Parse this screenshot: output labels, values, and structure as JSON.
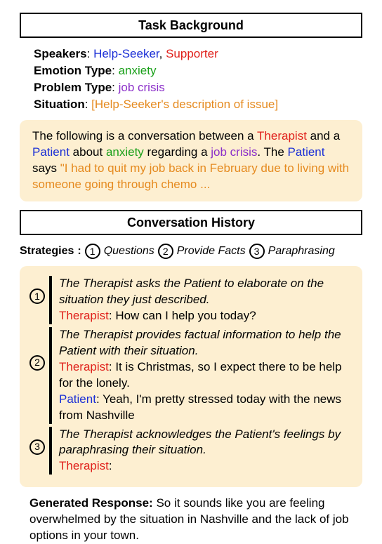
{
  "headings": {
    "task_background": "Task Background",
    "conversation_history": "Conversation History"
  },
  "meta": {
    "speakers_label": "Speakers",
    "speaker1": "Help-Seeker",
    "speaker2": "Supporter",
    "emotion_label": "Emotion Type",
    "emotion_value": "anxiety",
    "problem_label": "Problem Type",
    "problem_value": "job crisis",
    "situation_label": "Situation",
    "situation_value": "[Help-Seeker's description of issue]"
  },
  "prompt": {
    "t1": "The following is a conversation between a ",
    "therapist": "Therapist",
    "t2": " and a ",
    "patient": "Patient",
    "t3": " about ",
    "anxiety": "anxiety",
    "t4": " regarding a ",
    "jobcrisis": "job crisis",
    "t5": ". The ",
    "patient2": "Patient",
    "t6": " says ",
    "quote": "\"I had to quit my job back in February due to living with someone going through chemo ..."
  },
  "strategies": {
    "label": "Strategies",
    "s1": "Questions",
    "s2": "Provide Facts",
    "s3": "Paraphrasing"
  },
  "turns": {
    "t1": {
      "desc": "The Therapist asks the Patient to elaborate on the situation they just described.",
      "sp1": "Therapist",
      "u1": ": How can I help you today?"
    },
    "t2": {
      "desc": "The Therapist provides factual information to help the Patient with their situation.",
      "sp1": "Therapist",
      "u1": ": It is Christmas, so I expect there to be help for the lonely.",
      "sp2": "Patient",
      "u2": ": Yeah, I'm pretty stressed today with the news from Nashville"
    },
    "t3": {
      "desc": "The Therapist acknowledges the Patient's feelings by paraphrasing their situation.",
      "sp1": "Therapist",
      "u1": ":"
    }
  },
  "generated": {
    "label": "Generated Response:",
    "text": " So it sounds like you are feeling overwhelmed by the situation in Nashville and the lack of job options in your town."
  }
}
